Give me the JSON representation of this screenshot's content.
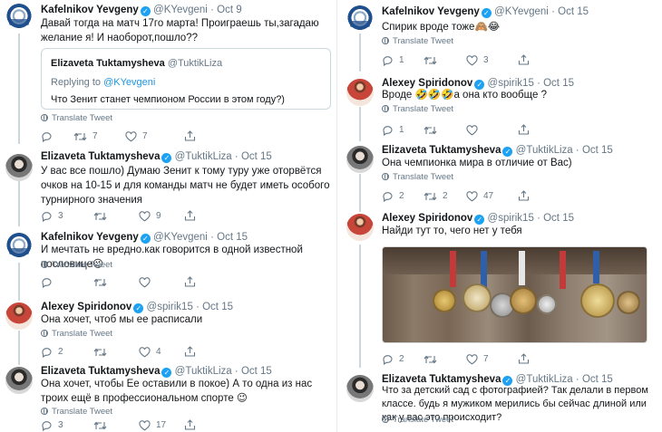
{
  "translate_label": "Translate Tweet",
  "colors": {
    "accent": "#1da1f2",
    "text": "#14171a",
    "muted": "#657786",
    "line": "#ccd6dd"
  },
  "icons": [
    "reply-icon",
    "retweet-icon",
    "like-icon",
    "share-icon",
    "verified-badge-icon",
    "globe-icon"
  ],
  "left": {
    "tweets": [
      {
        "name": "Kafelnikov Yevgeny",
        "handle": "@KYevgeni",
        "date": "Oct 9",
        "text": "Давай тогда на матч 17го марта! Проиграешь ты,загадаю желание я! И наоборот,пошло??",
        "quote": {
          "name": "Elizaveta Tuktamysheva",
          "handle": "@TuktikLiza",
          "replying_prefix": "Replying to",
          "replying_to": "@KYevgeni",
          "text": "Что Зенит станет чемпионом России в этом году?)"
        },
        "replies": "",
        "retweets": "7",
        "likes": "7"
      },
      {
        "name": "Elizaveta Tuktamysheva",
        "handle": "@TuktikLiza",
        "date": "Oct 15",
        "text": "У вас все пошло) Думаю Зенит к тому туру уже оторвётся очков на 10-15 и для команды матч не будет иметь особого турнирного значения",
        "replies": "3",
        "retweets": "",
        "likes": "9"
      },
      {
        "name": "Kafelnikov Yevgeny",
        "handle": "@KYevgeni",
        "date": "Oct 15",
        "text": "И мечтать не вредно.как говорится в одной известной пословице😉",
        "replies": "",
        "retweets": "",
        "likes": ""
      },
      {
        "name": "Alexey Spiridonov",
        "handle": "@spirik15",
        "date": "Oct 15",
        "text": "Она хочет, чтоб мы ее расписали",
        "replies": "2",
        "retweets": "",
        "likes": "4"
      },
      {
        "name": "Elizaveta Tuktamysheva",
        "handle": "@TuktikLiza",
        "date": "Oct 15",
        "text": "Она хочет, чтобы Ее оставили в покое) А то одна из нас троих ещё в профессиональном спорте 😉",
        "replies": "3",
        "retweets": "",
        "likes": "17"
      }
    ]
  },
  "right": {
    "tweets": [
      {
        "name": "Kafelnikov Yevgeny",
        "handle": "@KYevgeni",
        "date": "Oct 15",
        "text": "Спирик вроде тоже🙈😂",
        "replies": "1",
        "retweets": "",
        "likes": "3"
      },
      {
        "name": "Alexey Spiridonov",
        "handle": "@spirik15",
        "date": "Oct 15",
        "text": "Вроде 🤣🤣🤣а она кто вообще ?",
        "replies": "1",
        "retweets": "",
        "likes": ""
      },
      {
        "name": "Elizaveta Tuktamysheva",
        "handle": "@TuktikLiza",
        "date": "Oct 15",
        "text": "Она чемпионка мира в отличие от Вас)",
        "replies": "2",
        "retweets": "2",
        "likes": "47"
      },
      {
        "name": "Alexey Spiridonov",
        "handle": "@spirik15",
        "date": "Oct 15",
        "text": "Найди тут то, чего нет у тебя",
        "replies": "2",
        "retweets": "",
        "likes": "7"
      },
      {
        "name": "Elizaveta Tuktamysheva",
        "handle": "@TuktikLiza",
        "date": "Oct 15",
        "text": "Что за детский сад с фотографией? Так делали в первом классе. будь я мужиком мерились бы сейчас длиной или как у вас это происходит?",
        "replies": "",
        "retweets": "",
        "likes": ""
      }
    ]
  }
}
